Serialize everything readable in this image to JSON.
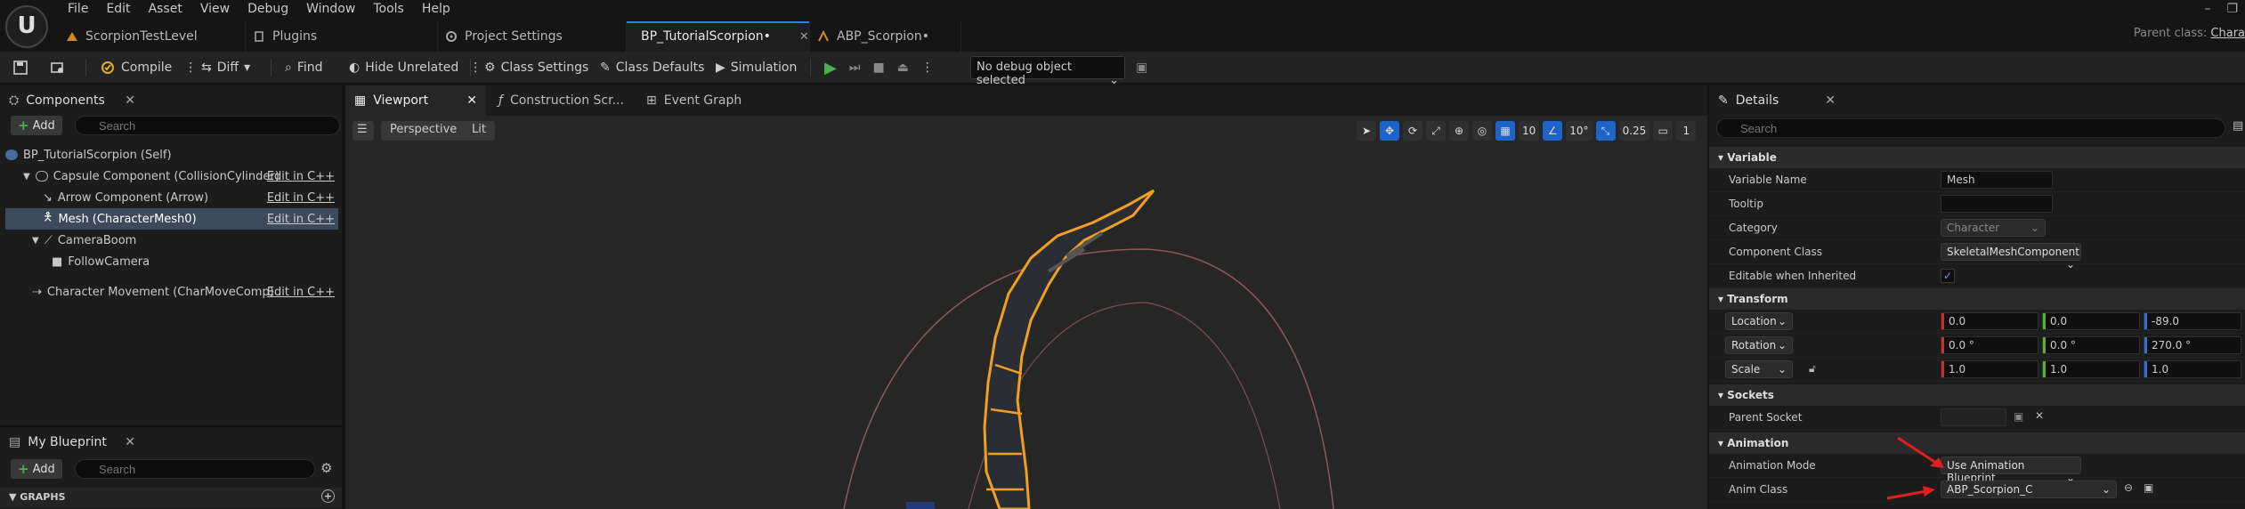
{
  "menu": [
    "File",
    "Edit",
    "Asset",
    "View",
    "Debug",
    "Window",
    "Tools",
    "Help"
  ],
  "logo_text": "U",
  "tabs": [
    {
      "label": "ScorpionTestLevel",
      "icon": "level-icon"
    },
    {
      "label": "Plugins",
      "icon": "plugin-icon"
    },
    {
      "label": "Project Settings",
      "icon": "settings-icon"
    },
    {
      "label": "BP_TutorialScorpion•",
      "icon": "blueprint-icon",
      "close": "✕"
    },
    {
      "label": "ABP_Scorpion•",
      "icon": "anim-blueprint-icon"
    }
  ],
  "parent_class": {
    "label": "Parent class:",
    "value": "Chara"
  },
  "toolbar": {
    "compile": "Compile",
    "diff": "Diff",
    "find": "Find",
    "hide_unrelated": "Hide Unrelated",
    "class_settings": "Class Settings",
    "class_defaults": "Class Defaults",
    "simulation": "Simulation",
    "debug_object": "No debug object selected"
  },
  "components_panel": {
    "title": "Components",
    "add": "Add",
    "search_placeholder": "Search",
    "items": [
      {
        "label": "BP_TutorialScorpion (Self)",
        "edit": ""
      },
      {
        "label": "Capsule Component (CollisionCylinder)",
        "edit": "Edit in C++"
      },
      {
        "label": "Arrow Component (Arrow)",
        "edit": "Edit in C++"
      },
      {
        "label": "Mesh (CharacterMesh0)",
        "edit": "Edit in C++"
      },
      {
        "label": "CameraBoom",
        "edit": ""
      },
      {
        "label": "FollowCamera",
        "edit": ""
      },
      {
        "label": "Character Movement (CharMoveComp)",
        "edit": "Edit in C++"
      }
    ]
  },
  "my_blueprint": {
    "title": "My Blueprint",
    "add": "Add",
    "search_placeholder": "Search",
    "graphs": "GRAPHS"
  },
  "viewport": {
    "tabs": [
      "Viewport",
      "Construction Scr...",
      "Event Graph"
    ],
    "perspective": "Perspective",
    "lit": "Lit",
    "grid_snap": "10",
    "rot_snap": "10°",
    "scale_snap": "0.25",
    "cam_speed": "1"
  },
  "details": {
    "title": "Details",
    "search_placeholder": "Search",
    "variable": {
      "header": "Variable",
      "name_label": "Variable Name",
      "name_value": "Mesh",
      "tooltip_label": "Tooltip",
      "tooltip_value": "",
      "category_label": "Category",
      "category_value": "Character",
      "component_class_label": "Component Class",
      "component_class_value": "SkeletalMeshComponent",
      "editable_label": "Editable when Inherited",
      "editable_checked": "✓"
    },
    "transform": {
      "header": "Transform",
      "location_label": "Location",
      "location": [
        "0.0",
        "0.0",
        "-89.0"
      ],
      "rotation_label": "Rotation",
      "rotation": [
        "0.0 °",
        "0.0 °",
        "270.0 °"
      ],
      "scale_label": "Scale",
      "scale": [
        "1.0",
        "1.0",
        "1.0"
      ]
    },
    "sockets": {
      "header": "Sockets",
      "parent_socket_label": "Parent Socket",
      "parent_socket_value": ""
    },
    "animation": {
      "header": "Animation",
      "mode_label": "Animation Mode",
      "mode_value": "Use Animation Blueprint",
      "class_label": "Anim Class",
      "class_value": "ABP_Scorpion_C"
    }
  },
  "colors": {
    "accent": "#2a7fff",
    "selection": "#3d4a5c",
    "mesh_outline": "#f0a020",
    "arrow": "#e02020",
    "play": "#4caf50"
  }
}
